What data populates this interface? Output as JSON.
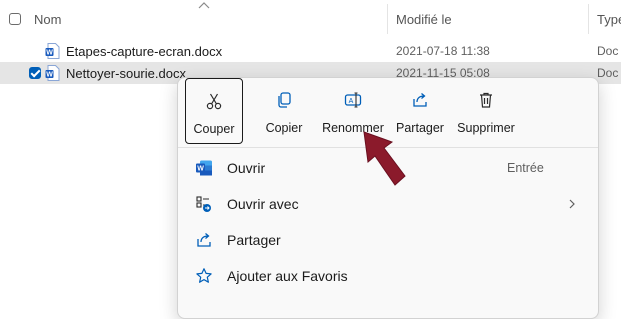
{
  "header": {
    "col_name": "Nom",
    "col_modified": "Modifié le",
    "col_type": "Type"
  },
  "files": [
    {
      "name": "Etapes-capture-ecran.docx",
      "modified": "2021-07-18 11:38",
      "type": "Doc",
      "selected": false
    },
    {
      "name": "Nettoyer-sourie.docx",
      "modified": "2021-11-15 05:08",
      "type": "Doc",
      "selected": true
    }
  ],
  "context_menu": {
    "quick_actions": [
      {
        "label": "Couper",
        "icon": "scissors-icon"
      },
      {
        "label": "Copier",
        "icon": "copy-icon"
      },
      {
        "label": "Renommer",
        "icon": "rename-icon"
      },
      {
        "label": "Partager",
        "icon": "share-icon"
      },
      {
        "label": "Supprimer",
        "icon": "trash-icon"
      }
    ],
    "items": [
      {
        "label": "Ouvrir",
        "hint": "Entrée",
        "icon": "word-icon"
      },
      {
        "label": "Ouvrir avec",
        "hint": "",
        "icon": "open-with-icon",
        "submenu": true
      },
      {
        "label": "Partager",
        "hint": "",
        "icon": "share-icon"
      },
      {
        "label": "Ajouter aux Favoris",
        "hint": "",
        "icon": "star-icon"
      }
    ]
  },
  "colors": {
    "accent": "#005fb8",
    "selection": "#e5e5e5",
    "arrow": "#8b1a2b",
    "word_blue": "#185abd"
  }
}
